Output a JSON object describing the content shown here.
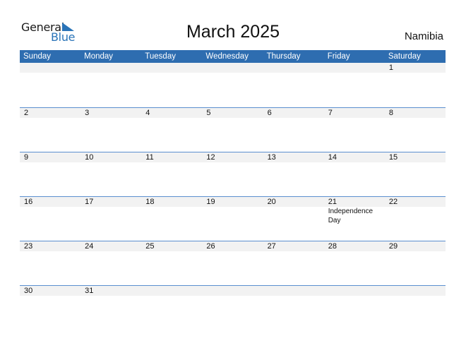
{
  "logo": {
    "line1": "General",
    "line2": "Blue"
  },
  "title": "March 2025",
  "country": "Namibia",
  "colors": {
    "header_bg": "#2e6db0",
    "band_bg": "#f2f2f2",
    "accent": "#2a74b8"
  },
  "weekdays": [
    "Sunday",
    "Monday",
    "Tuesday",
    "Wednesday",
    "Thursday",
    "Friday",
    "Saturday"
  ],
  "weeks": [
    {
      "days": [
        "",
        "",
        "",
        "",
        "",
        "",
        "1"
      ],
      "events": [
        "",
        "",
        "",
        "",
        "",
        "",
        ""
      ]
    },
    {
      "days": [
        "2",
        "3",
        "4",
        "5",
        "6",
        "7",
        "8"
      ],
      "events": [
        "",
        "",
        "",
        "",
        "",
        "",
        ""
      ]
    },
    {
      "days": [
        "9",
        "10",
        "11",
        "12",
        "13",
        "14",
        "15"
      ],
      "events": [
        "",
        "",
        "",
        "",
        "",
        "",
        ""
      ]
    },
    {
      "days": [
        "16",
        "17",
        "18",
        "19",
        "20",
        "21",
        "22"
      ],
      "events": [
        "",
        "",
        "",
        "",
        "",
        "Independence Day",
        ""
      ]
    },
    {
      "days": [
        "23",
        "24",
        "25",
        "26",
        "27",
        "28",
        "29"
      ],
      "events": [
        "",
        "",
        "",
        "",
        "",
        "",
        ""
      ]
    },
    {
      "days": [
        "30",
        "31",
        "",
        "",
        "",
        "",
        ""
      ],
      "events": [
        "",
        "",
        "",
        "",
        "",
        "",
        ""
      ]
    }
  ]
}
